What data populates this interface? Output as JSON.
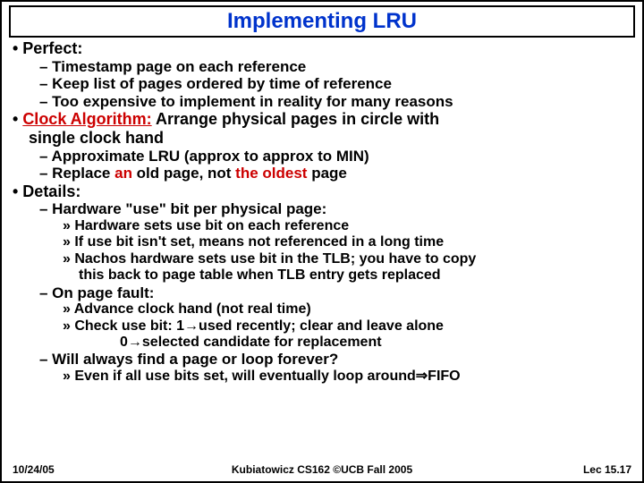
{
  "title": "Implementing LRU",
  "bullets": {
    "perfect": "• Perfect:",
    "p1": "– Timestamp page on each reference",
    "p2": "– Keep list of pages ordered by time of reference",
    "p3": "– Too expensive to implement in reality for many reasons",
    "clock_label": "Clock Algorithm:",
    "clock_rest1": " Arrange physical pages in circle with",
    "clock_rest2": "single clock hand",
    "c1": "– Approximate LRU (approx to approx to MIN)",
    "c2a": "– Replace ",
    "c2b": "an",
    "c2c": " old page, not ",
    "c2d": "the oldest",
    "c2e": " page",
    "details": "• Details:",
    "d1": "– Hardware \"use\" bit per physical page:",
    "d1a": "» Hardware sets use bit on each reference",
    "d1b": "» If use bit isn't set, means not referenced in a long time",
    "d1c": "» Nachos hardware sets use bit in the TLB; you have to copy",
    "d1c2": "this back to page table when TLB entry gets replaced",
    "d2": "– On page fault:",
    "d2a": "» Advance clock hand (not real time)",
    "d2b": "» Check use bit: 1→used recently; clear and leave alone",
    "d2b2": "0→selected candidate for replacement",
    "d3": "– Will always find a page or loop forever?",
    "d3a": "» Even if all use bits set, will eventually loop around⇒FIFO"
  },
  "footer": {
    "date": "10/24/05",
    "center": "Kubiatowicz CS162 ©UCB Fall 2005",
    "page": "Lec 15.17"
  }
}
